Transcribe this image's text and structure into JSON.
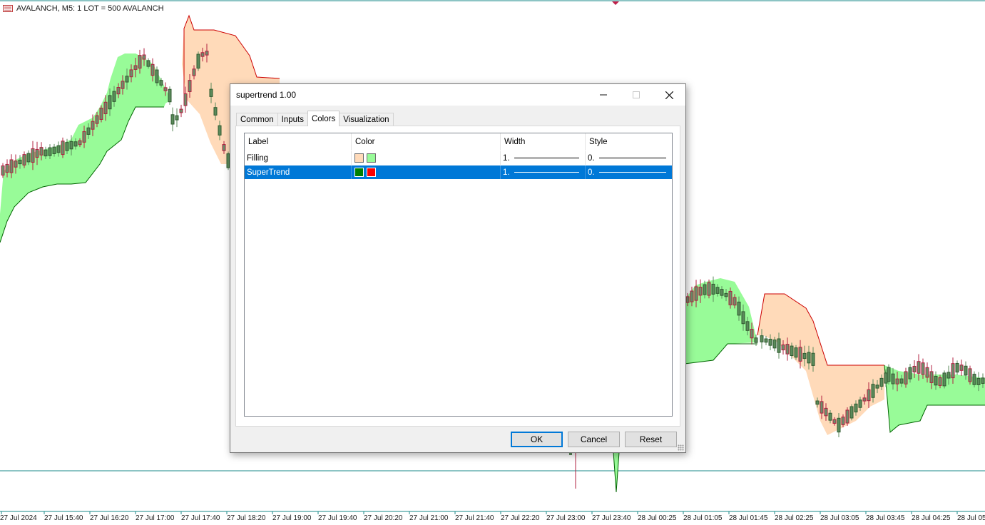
{
  "chart": {
    "symbol_title": "AVALANCH, M5:  1 LOT = 500 AVALANCH",
    "time_labels": [
      "27 Jul 2024",
      "27 Jul 15:40",
      "27 Jul 16:20",
      "27 Jul 17:00",
      "27 Jul 17:40",
      "27 Jul 18:20",
      "27 Jul 19:00",
      "27 Jul 19:40",
      "27 Jul 20:20",
      "27 Jul 21:00",
      "27 Jul 21:40",
      "27 Jul 22:20",
      "27 Jul 23:00",
      "27 Jul 23:40",
      "28 Jul 00:25",
      "28 Jul 01:05",
      "28 Jul 01:45",
      "28 Jul 02:25",
      "28 Jul 03:05",
      "28 Jul 03:45",
      "28 Jul 04:25",
      "28 Jul 05"
    ],
    "colors": {
      "bull_candle": "#5b8a5b",
      "bear_candle": "#b02040",
      "uptrend_fill": "#98fb98",
      "downtrend_fill": "#ffdab9",
      "uptrend_line": "#006400",
      "downtrend_line": "#cc0000",
      "grid_line": "#1a8a8a"
    }
  },
  "dialog": {
    "title": "supertrend 1.00",
    "minimize_icon": "minimize-icon",
    "maximize_icon": "maximize-icon",
    "close_icon": "close-icon",
    "tabs": [
      {
        "label": "Common"
      },
      {
        "label": "Inputs"
      },
      {
        "label": "Colors",
        "active": true
      },
      {
        "label": "Visualization"
      }
    ],
    "table": {
      "headers": [
        "Label",
        "Color",
        "Width",
        "Style"
      ],
      "rows": [
        {
          "label": "Filling",
          "colors": [
            "#ffdab9",
            "#98fb98"
          ],
          "width": "1.",
          "style": "0.",
          "selected": false
        },
        {
          "label": "SuperTrend",
          "colors": [
            "#008000",
            "#ff0000"
          ],
          "width": "1.",
          "style": "0.",
          "selected": true
        }
      ]
    },
    "buttons": {
      "ok": "OK",
      "cancel": "Cancel",
      "reset": "Reset"
    }
  }
}
